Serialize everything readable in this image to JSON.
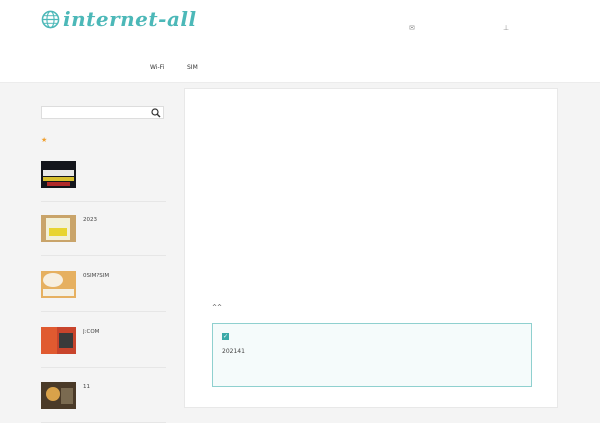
{
  "header": {
    "site_name": "internet-all",
    "tagline": "",
    "links": [
      {
        "label": "",
        "icon": "mail-icon"
      },
      {
        "label": "",
        "icon": "sitemap-icon"
      }
    ]
  },
  "nav": {
    "items": [
      "",
      "",
      "",
      "",
      "Wi-Fi",
      "SIM",
      "",
      "",
      ""
    ]
  },
  "sidebar": {
    "search_title": "",
    "search_placeholder": "",
    "recommend_title": "",
    "items": [
      {
        "title": ""
      },
      {
        "title": "2023"
      },
      {
        "title": "0SIM?SIM"
      },
      {
        "title": "J:COM"
      },
      {
        "title": "11"
      }
    ]
  },
  "article": {
    "title": "",
    "paragraphs": [
      "",
      "",
      ""
    ],
    "bullets": [
      "",
      ""
    ],
    "subheading": "",
    "closing": "^^",
    "notice": {
      "title": "",
      "body": "202141"
    }
  },
  "colors": {
    "accent": "#4cb8b8",
    "notice_border": "#8fd0cf",
    "star": "#f0a030"
  }
}
